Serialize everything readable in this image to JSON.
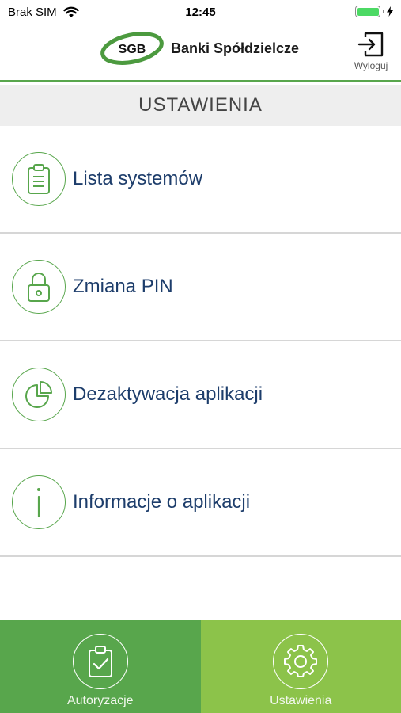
{
  "status_bar": {
    "carrier": "Brak SIM",
    "time": "12:45",
    "battery_level": 1.0,
    "icons": [
      "wifi-icon",
      "battery-icon",
      "charging-bolt-icon"
    ]
  },
  "header": {
    "logo_text": "SGB",
    "brand_name": "Banki Spółdzielcze",
    "logout_label": "Wyloguj",
    "logout_icon": "logout-icon"
  },
  "section": {
    "title": "USTAWIENIA"
  },
  "menu": {
    "items": [
      {
        "label": "Lista systemów",
        "icon": "clipboard-icon"
      },
      {
        "label": "Zmiana PIN",
        "icon": "lock-icon"
      },
      {
        "label": "Dezaktywacja aplikacji",
        "icon": "pie-chart-icon"
      },
      {
        "label": "Informacje o aplikacji",
        "icon": "info-icon"
      }
    ]
  },
  "tab_bar": {
    "tabs": [
      {
        "label": "Autoryzacje",
        "icon": "clipboard-check-icon",
        "active": false
      },
      {
        "label": "Ustawienia",
        "icon": "gear-icon",
        "active": true
      }
    ]
  },
  "colors": {
    "brand_green": "#58a64c",
    "active_tab_green": "#8cc34a",
    "label_navy": "#1d3d6b",
    "section_bg": "#eeeeee"
  }
}
